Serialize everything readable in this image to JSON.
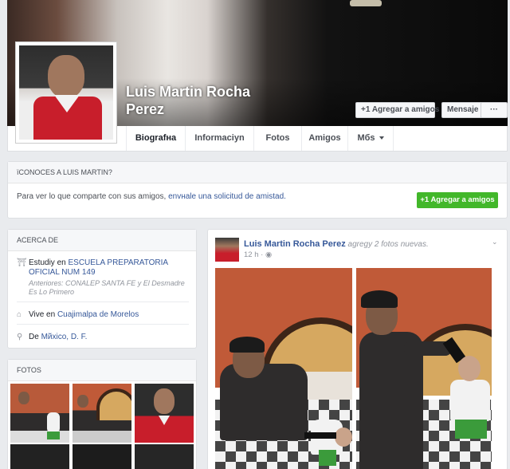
{
  "profile": {
    "name": "Luis Martin Rocha Perez",
    "buttons": {
      "add_friend": "Agregar a amigos",
      "message": "Mensaje",
      "more": "···"
    }
  },
  "nav": {
    "tabs": [
      {
        "label": "Biografнa",
        "active": true
      },
      {
        "label": "Informaciуn"
      },
      {
        "label": "Fotos"
      },
      {
        "label": "Amigos"
      },
      {
        "label": "Mбs"
      }
    ]
  },
  "know": {
    "heading": "їCONOCES A LUIS MARTIN?",
    "text_before": "Para ver lo que comparte con sus amigos, ",
    "link": "envнale una solicitud de amistad.",
    "button": "Agregar a amigos"
  },
  "about": {
    "heading": "ACERCA DE",
    "study_prefix": "Estudiу en ",
    "study_school": "ESCUELA PREPARATORIA OFICIAL NUM 149",
    "study_previous": "Anteriores: CONALEP SANTA FE y El Desmadre Es Lo Primero",
    "lives_prefix": "Vive en ",
    "lives_place": "Cuajimalpa de Morelos",
    "from_prefix": "De ",
    "from_place": "Mйxico, D. F."
  },
  "photos": {
    "heading": "FOTOS"
  },
  "post": {
    "author": "Luis Martin Rocha Perez",
    "action": " agregу 2 fotos nuevas.",
    "time": "12 h · "
  },
  "colors": {
    "fb_blue": "#365899",
    "green_button": "#42b72a",
    "background": "#e9ebee"
  },
  "icons": [
    "user-plus-icon",
    "school-icon",
    "home-icon",
    "location-pin-icon",
    "globe-icon",
    "chevron-down-icon"
  ]
}
